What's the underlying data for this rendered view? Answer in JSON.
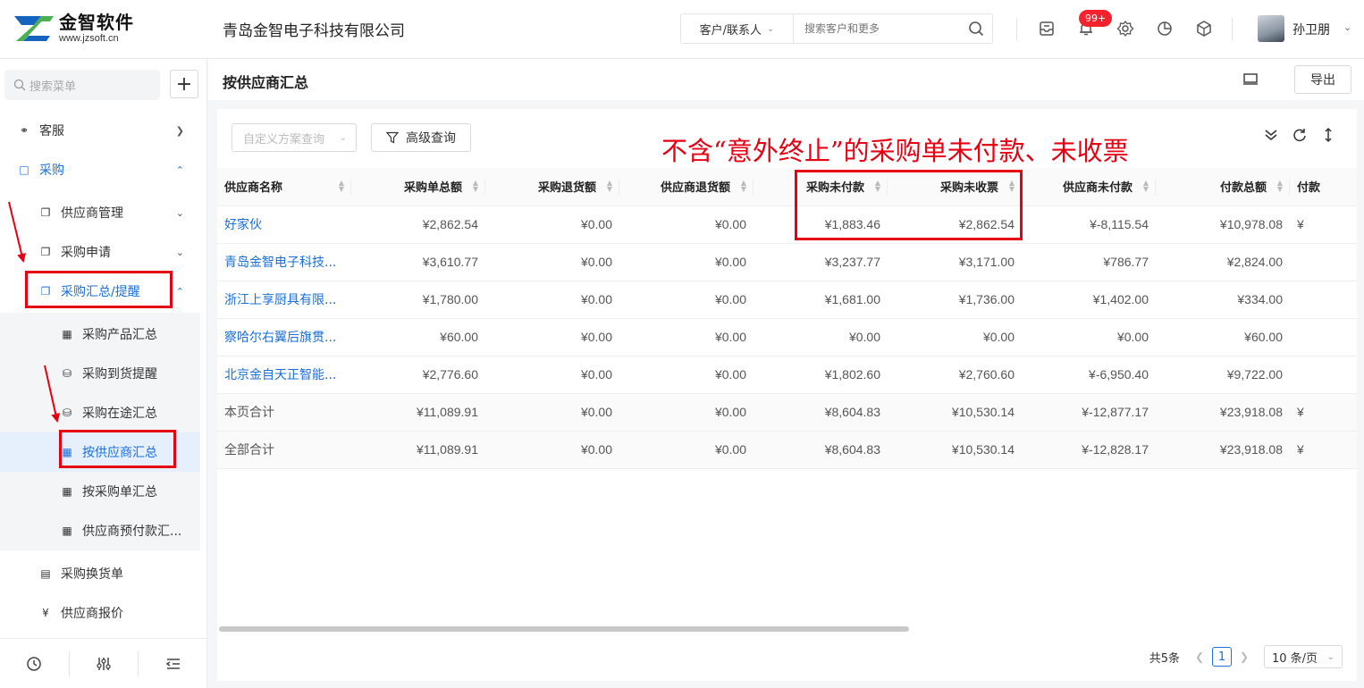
{
  "header": {
    "logo_name": "金智软件",
    "logo_url": "www.jzsoft.cn",
    "company": "青岛金智电子科技有限公司",
    "search_scope": "客户/联系人",
    "search_placeholder": "搜索客户和更多",
    "notification_badge": "99+",
    "user_name": "孙卫朋",
    "brand_color": "#1a6fd8"
  },
  "sidebar": {
    "search_placeholder": "搜索菜单",
    "add_label": "+",
    "items": [
      {
        "label": "客服",
        "icon": "headset-icon"
      },
      {
        "label": "采购",
        "icon": "bag-icon"
      },
      {
        "label": "供应商管理",
        "icon": "copy-icon"
      },
      {
        "label": "采购申请",
        "icon": "copy-icon"
      },
      {
        "label": "采购汇总/提醒",
        "icon": "copy-icon"
      },
      {
        "label": "采购产品汇总",
        "icon": "calculator-icon"
      },
      {
        "label": "采购到货提醒",
        "icon": "truck-icon"
      },
      {
        "label": "采购在途汇总",
        "icon": "truck-icon"
      },
      {
        "label": "按供应商汇总",
        "icon": "calculator-icon"
      },
      {
        "label": "按采购单汇总",
        "icon": "calculator-icon"
      },
      {
        "label": "供应商预付款汇...",
        "icon": "calculator-icon"
      },
      {
        "label": "采购换货单",
        "icon": "exchange-icon"
      },
      {
        "label": "供应商报价",
        "icon": "yen-icon"
      }
    ]
  },
  "page": {
    "title": "按供应商汇总",
    "export_label": "导出",
    "custom_query_placeholder": "自定义方案查询",
    "advanced_query_label": "高级查询",
    "annotation": "不含“意外终止”的采购单未付款、未收票"
  },
  "table": {
    "columns": [
      "供应商名称",
      "采购单总额",
      "采购退货额",
      "供应商退货额",
      "采购未付款",
      "采购未收票",
      "供应商未付款",
      "付款总额",
      "付款"
    ],
    "rows": [
      [
        "好家伙",
        "¥2,862.54",
        "¥0.00",
        "¥0.00",
        "¥1,883.46",
        "¥2,862.54",
        "¥-8,115.54",
        "¥10,978.08",
        "¥"
      ],
      [
        "青岛金智电子科技...",
        "¥3,610.77",
        "¥0.00",
        "¥0.00",
        "¥3,237.77",
        "¥3,171.00",
        "¥786.77",
        "¥2,824.00",
        ""
      ],
      [
        "浙江上享厨具有限...",
        "¥1,780.00",
        "¥0.00",
        "¥0.00",
        "¥1,681.00",
        "¥1,736.00",
        "¥1,402.00",
        "¥334.00",
        ""
      ],
      [
        "察哈尔右翼后旗贯...",
        "¥60.00",
        "¥0.00",
        "¥0.00",
        "¥0.00",
        "¥0.00",
        "¥0.00",
        "¥60.00",
        ""
      ],
      [
        "北京金自天正智能...",
        "¥2,776.60",
        "¥0.00",
        "¥0.00",
        "¥1,802.60",
        "¥2,760.60",
        "¥-6,950.40",
        "¥9,722.00",
        ""
      ]
    ],
    "summary_rows": [
      [
        "本页合计",
        "¥11,089.91",
        "¥0.00",
        "¥0.00",
        "¥8,604.83",
        "¥10,530.14",
        "¥-12,877.17",
        "¥23,918.08",
        "¥"
      ],
      [
        "全部合计",
        "¥11,089.91",
        "¥0.00",
        "¥0.00",
        "¥8,604.83",
        "¥10,530.14",
        "¥-12,828.17",
        "¥23,918.08",
        "¥"
      ]
    ]
  },
  "pagination": {
    "total": "共5条",
    "current_page": "1",
    "page_size": "10 条/页"
  }
}
